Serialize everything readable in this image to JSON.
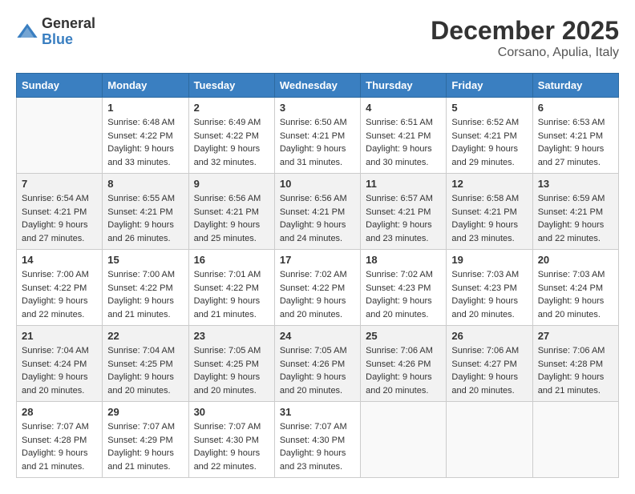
{
  "header": {
    "logo_general": "General",
    "logo_blue": "Blue",
    "month_title": "December 2025",
    "location": "Corsano, Apulia, Italy"
  },
  "calendar": {
    "days_of_week": [
      "Sunday",
      "Monday",
      "Tuesday",
      "Wednesday",
      "Thursday",
      "Friday",
      "Saturday"
    ],
    "weeks": [
      [
        {
          "day": "",
          "sunrise": "",
          "sunset": "",
          "daylight": ""
        },
        {
          "day": "1",
          "sunrise": "Sunrise: 6:48 AM",
          "sunset": "Sunset: 4:22 PM",
          "daylight": "Daylight: 9 hours and 33 minutes."
        },
        {
          "day": "2",
          "sunrise": "Sunrise: 6:49 AM",
          "sunset": "Sunset: 4:22 PM",
          "daylight": "Daylight: 9 hours and 32 minutes."
        },
        {
          "day": "3",
          "sunrise": "Sunrise: 6:50 AM",
          "sunset": "Sunset: 4:21 PM",
          "daylight": "Daylight: 9 hours and 31 minutes."
        },
        {
          "day": "4",
          "sunrise": "Sunrise: 6:51 AM",
          "sunset": "Sunset: 4:21 PM",
          "daylight": "Daylight: 9 hours and 30 minutes."
        },
        {
          "day": "5",
          "sunrise": "Sunrise: 6:52 AM",
          "sunset": "Sunset: 4:21 PM",
          "daylight": "Daylight: 9 hours and 29 minutes."
        },
        {
          "day": "6",
          "sunrise": "Sunrise: 6:53 AM",
          "sunset": "Sunset: 4:21 PM",
          "daylight": "Daylight: 9 hours and 27 minutes."
        }
      ],
      [
        {
          "day": "7",
          "sunrise": "Sunrise: 6:54 AM",
          "sunset": "Sunset: 4:21 PM",
          "daylight": "Daylight: 9 hours and 27 minutes."
        },
        {
          "day": "8",
          "sunrise": "Sunrise: 6:55 AM",
          "sunset": "Sunset: 4:21 PM",
          "daylight": "Daylight: 9 hours and 26 minutes."
        },
        {
          "day": "9",
          "sunrise": "Sunrise: 6:56 AM",
          "sunset": "Sunset: 4:21 PM",
          "daylight": "Daylight: 9 hours and 25 minutes."
        },
        {
          "day": "10",
          "sunrise": "Sunrise: 6:56 AM",
          "sunset": "Sunset: 4:21 PM",
          "daylight": "Daylight: 9 hours and 24 minutes."
        },
        {
          "day": "11",
          "sunrise": "Sunrise: 6:57 AM",
          "sunset": "Sunset: 4:21 PM",
          "daylight": "Daylight: 9 hours and 23 minutes."
        },
        {
          "day": "12",
          "sunrise": "Sunrise: 6:58 AM",
          "sunset": "Sunset: 4:21 PM",
          "daylight": "Daylight: 9 hours and 23 minutes."
        },
        {
          "day": "13",
          "sunrise": "Sunrise: 6:59 AM",
          "sunset": "Sunset: 4:21 PM",
          "daylight": "Daylight: 9 hours and 22 minutes."
        }
      ],
      [
        {
          "day": "14",
          "sunrise": "Sunrise: 7:00 AM",
          "sunset": "Sunset: 4:22 PM",
          "daylight": "Daylight: 9 hours and 22 minutes."
        },
        {
          "day": "15",
          "sunrise": "Sunrise: 7:00 AM",
          "sunset": "Sunset: 4:22 PM",
          "daylight": "Daylight: 9 hours and 21 minutes."
        },
        {
          "day": "16",
          "sunrise": "Sunrise: 7:01 AM",
          "sunset": "Sunset: 4:22 PM",
          "daylight": "Daylight: 9 hours and 21 minutes."
        },
        {
          "day": "17",
          "sunrise": "Sunrise: 7:02 AM",
          "sunset": "Sunset: 4:22 PM",
          "daylight": "Daylight: 9 hours and 20 minutes."
        },
        {
          "day": "18",
          "sunrise": "Sunrise: 7:02 AM",
          "sunset": "Sunset: 4:23 PM",
          "daylight": "Daylight: 9 hours and 20 minutes."
        },
        {
          "day": "19",
          "sunrise": "Sunrise: 7:03 AM",
          "sunset": "Sunset: 4:23 PM",
          "daylight": "Daylight: 9 hours and 20 minutes."
        },
        {
          "day": "20",
          "sunrise": "Sunrise: 7:03 AM",
          "sunset": "Sunset: 4:24 PM",
          "daylight": "Daylight: 9 hours and 20 minutes."
        }
      ],
      [
        {
          "day": "21",
          "sunrise": "Sunrise: 7:04 AM",
          "sunset": "Sunset: 4:24 PM",
          "daylight": "Daylight: 9 hours and 20 minutes."
        },
        {
          "day": "22",
          "sunrise": "Sunrise: 7:04 AM",
          "sunset": "Sunset: 4:25 PM",
          "daylight": "Daylight: 9 hours and 20 minutes."
        },
        {
          "day": "23",
          "sunrise": "Sunrise: 7:05 AM",
          "sunset": "Sunset: 4:25 PM",
          "daylight": "Daylight: 9 hours and 20 minutes."
        },
        {
          "day": "24",
          "sunrise": "Sunrise: 7:05 AM",
          "sunset": "Sunset: 4:26 PM",
          "daylight": "Daylight: 9 hours and 20 minutes."
        },
        {
          "day": "25",
          "sunrise": "Sunrise: 7:06 AM",
          "sunset": "Sunset: 4:26 PM",
          "daylight": "Daylight: 9 hours and 20 minutes."
        },
        {
          "day": "26",
          "sunrise": "Sunrise: 7:06 AM",
          "sunset": "Sunset: 4:27 PM",
          "daylight": "Daylight: 9 hours and 20 minutes."
        },
        {
          "day": "27",
          "sunrise": "Sunrise: 7:06 AM",
          "sunset": "Sunset: 4:28 PM",
          "daylight": "Daylight: 9 hours and 21 minutes."
        }
      ],
      [
        {
          "day": "28",
          "sunrise": "Sunrise: 7:07 AM",
          "sunset": "Sunset: 4:28 PM",
          "daylight": "Daylight: 9 hours and 21 minutes."
        },
        {
          "day": "29",
          "sunrise": "Sunrise: 7:07 AM",
          "sunset": "Sunset: 4:29 PM",
          "daylight": "Daylight: 9 hours and 21 minutes."
        },
        {
          "day": "30",
          "sunrise": "Sunrise: 7:07 AM",
          "sunset": "Sunset: 4:30 PM",
          "daylight": "Daylight: 9 hours and 22 minutes."
        },
        {
          "day": "31",
          "sunrise": "Sunrise: 7:07 AM",
          "sunset": "Sunset: 4:30 PM",
          "daylight": "Daylight: 9 hours and 23 minutes."
        },
        {
          "day": "",
          "sunrise": "",
          "sunset": "",
          "daylight": ""
        },
        {
          "day": "",
          "sunrise": "",
          "sunset": "",
          "daylight": ""
        },
        {
          "day": "",
          "sunrise": "",
          "sunset": "",
          "daylight": ""
        }
      ]
    ]
  }
}
